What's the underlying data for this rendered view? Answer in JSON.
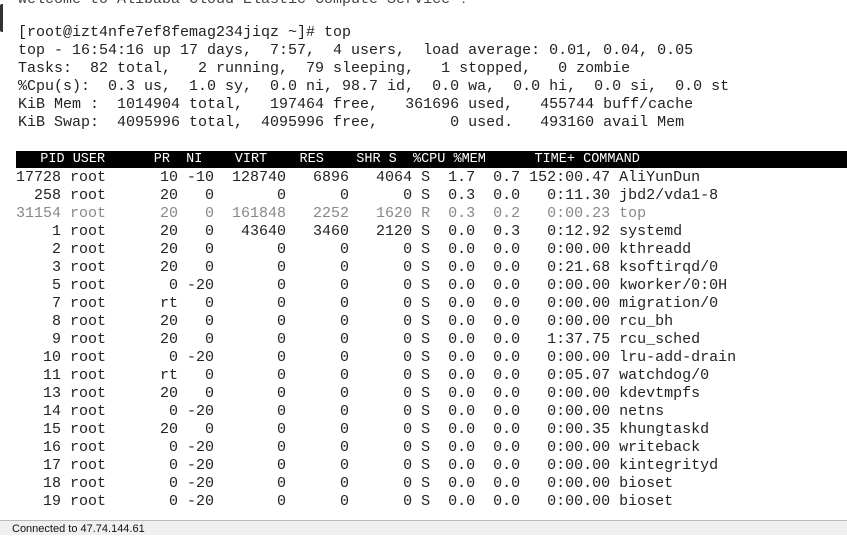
{
  "terminal": {
    "cut_top_line": "Welcome to Alibaba Cloud Elastic Compute Service !",
    "prompt_line": "[root@izt4nfe7ef8femag234jiqz ~]# top",
    "summary": [
      "top - 16:54:16 up 17 days,  7:57,  4 users,  load average: 0.01, 0.04, 0.05",
      "Tasks:  82 total,   2 running,  79 sleeping,   1 stopped,   0 zombie",
      "%Cpu(s):  0.3 us,  1.0 sy,  0.0 ni, 98.7 id,  0.0 wa,  0.0 hi,  0.0 si,  0.0 st",
      "KiB Mem :  1014904 total,   197464 free,   361696 used,   455744 buff/cache",
      "KiB Swap:  4095996 total,  4095996 free,        0 used.   493160 avail Mem"
    ],
    "columns": [
      "PID",
      "USER",
      "PR",
      "NI",
      "VIRT",
      "RES",
      "SHR",
      "S",
      "%CPU",
      "%MEM",
      "TIME+",
      "COMMAND"
    ],
    "processes": [
      {
        "pid": "17728",
        "user": "root",
        "pr": "10",
        "ni": "-10",
        "virt": "128740",
        "res": "6896",
        "shr": "4064",
        "s": "S",
        "cpu": "1.7",
        "mem": "0.7",
        "time": "152:00.47",
        "cmd": "AliYunDun",
        "dim": false
      },
      {
        "pid": "258",
        "user": "root",
        "pr": "20",
        "ni": "0",
        "virt": "0",
        "res": "0",
        "shr": "0",
        "s": "S",
        "cpu": "0.3",
        "mem": "0.0",
        "time": "0:11.30",
        "cmd": "jbd2/vda1-8",
        "dim": false
      },
      {
        "pid": "31154",
        "user": "root",
        "pr": "20",
        "ni": "0",
        "virt": "161848",
        "res": "2252",
        "shr": "1620",
        "s": "R",
        "cpu": "0.3",
        "mem": "0.2",
        "time": "0:00.23",
        "cmd": "top",
        "dim": true
      },
      {
        "pid": "1",
        "user": "root",
        "pr": "20",
        "ni": "0",
        "virt": "43640",
        "res": "3460",
        "shr": "2120",
        "s": "S",
        "cpu": "0.0",
        "mem": "0.3",
        "time": "0:12.92",
        "cmd": "systemd",
        "dim": false
      },
      {
        "pid": "2",
        "user": "root",
        "pr": "20",
        "ni": "0",
        "virt": "0",
        "res": "0",
        "shr": "0",
        "s": "S",
        "cpu": "0.0",
        "mem": "0.0",
        "time": "0:00.00",
        "cmd": "kthreadd",
        "dim": false
      },
      {
        "pid": "3",
        "user": "root",
        "pr": "20",
        "ni": "0",
        "virt": "0",
        "res": "0",
        "shr": "0",
        "s": "S",
        "cpu": "0.0",
        "mem": "0.0",
        "time": "0:21.68",
        "cmd": "ksoftirqd/0",
        "dim": false
      },
      {
        "pid": "5",
        "user": "root",
        "pr": "0",
        "ni": "-20",
        "virt": "0",
        "res": "0",
        "shr": "0",
        "s": "S",
        "cpu": "0.0",
        "mem": "0.0",
        "time": "0:00.00",
        "cmd": "kworker/0:0H",
        "dim": false
      },
      {
        "pid": "7",
        "user": "root",
        "pr": "rt",
        "ni": "0",
        "virt": "0",
        "res": "0",
        "shr": "0",
        "s": "S",
        "cpu": "0.0",
        "mem": "0.0",
        "time": "0:00.00",
        "cmd": "migration/0",
        "dim": false
      },
      {
        "pid": "8",
        "user": "root",
        "pr": "20",
        "ni": "0",
        "virt": "0",
        "res": "0",
        "shr": "0",
        "s": "S",
        "cpu": "0.0",
        "mem": "0.0",
        "time": "0:00.00",
        "cmd": "rcu_bh",
        "dim": false
      },
      {
        "pid": "9",
        "user": "root",
        "pr": "20",
        "ni": "0",
        "virt": "0",
        "res": "0",
        "shr": "0",
        "s": "S",
        "cpu": "0.0",
        "mem": "0.0",
        "time": "1:37.75",
        "cmd": "rcu_sched",
        "dim": false
      },
      {
        "pid": "10",
        "user": "root",
        "pr": "0",
        "ni": "-20",
        "virt": "0",
        "res": "0",
        "shr": "0",
        "s": "S",
        "cpu": "0.0",
        "mem": "0.0",
        "time": "0:00.00",
        "cmd": "lru-add-drain",
        "dim": false
      },
      {
        "pid": "11",
        "user": "root",
        "pr": "rt",
        "ni": "0",
        "virt": "0",
        "res": "0",
        "shr": "0",
        "s": "S",
        "cpu": "0.0",
        "mem": "0.0",
        "time": "0:05.07",
        "cmd": "watchdog/0",
        "dim": false
      },
      {
        "pid": "13",
        "user": "root",
        "pr": "20",
        "ni": "0",
        "virt": "0",
        "res": "0",
        "shr": "0",
        "s": "S",
        "cpu": "0.0",
        "mem": "0.0",
        "time": "0:00.00",
        "cmd": "kdevtmpfs",
        "dim": false
      },
      {
        "pid": "14",
        "user": "root",
        "pr": "0",
        "ni": "-20",
        "virt": "0",
        "res": "0",
        "shr": "0",
        "s": "S",
        "cpu": "0.0",
        "mem": "0.0",
        "time": "0:00.00",
        "cmd": "netns",
        "dim": false
      },
      {
        "pid": "15",
        "user": "root",
        "pr": "20",
        "ni": "0",
        "virt": "0",
        "res": "0",
        "shr": "0",
        "s": "S",
        "cpu": "0.0",
        "mem": "0.0",
        "time": "0:00.35",
        "cmd": "khungtaskd",
        "dim": false
      },
      {
        "pid": "16",
        "user": "root",
        "pr": "0",
        "ni": "-20",
        "virt": "0",
        "res": "0",
        "shr": "0",
        "s": "S",
        "cpu": "0.0",
        "mem": "0.0",
        "time": "0:00.00",
        "cmd": "writeback",
        "dim": false
      },
      {
        "pid": "17",
        "user": "root",
        "pr": "0",
        "ni": "-20",
        "virt": "0",
        "res": "0",
        "shr": "0",
        "s": "S",
        "cpu": "0.0",
        "mem": "0.0",
        "time": "0:00.00",
        "cmd": "kintegrityd",
        "dim": false
      },
      {
        "pid": "18",
        "user": "root",
        "pr": "0",
        "ni": "-20",
        "virt": "0",
        "res": "0",
        "shr": "0",
        "s": "S",
        "cpu": "0.0",
        "mem": "0.0",
        "time": "0:00.00",
        "cmd": "bioset",
        "dim": false
      },
      {
        "pid": "19",
        "user": "root",
        "pr": "0",
        "ni": "-20",
        "virt": "0",
        "res": "0",
        "shr": "0",
        "s": "S",
        "cpu": "0.0",
        "mem": "0.0",
        "time": "0:00.00",
        "cmd": "bioset",
        "dim": false
      }
    ]
  },
  "statusbar": {
    "text": "Connected to 47.74.144.61"
  }
}
